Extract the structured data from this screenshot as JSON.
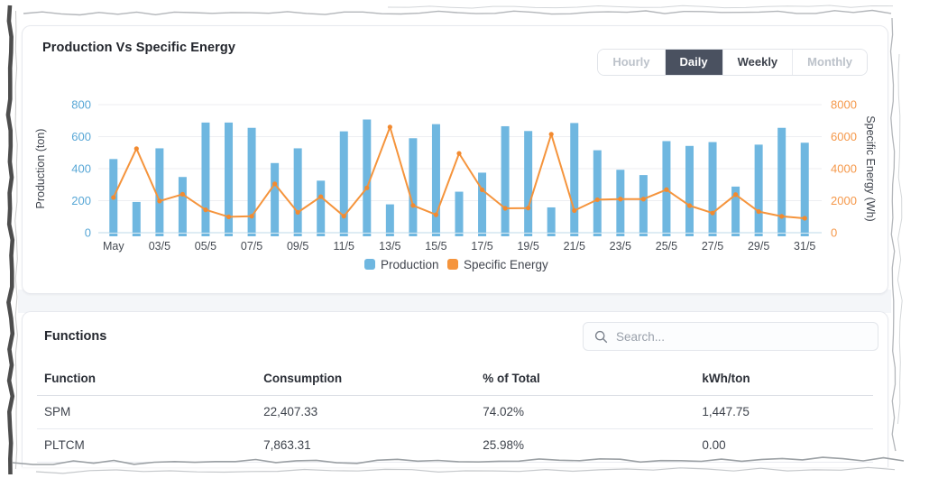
{
  "chart_card": {
    "title": "Production Vs Specific Energy",
    "range_tabs": [
      {
        "label": "Hourly",
        "state": "muted"
      },
      {
        "label": "Daily",
        "state": "active"
      },
      {
        "label": "Weekly",
        "state": "normal"
      },
      {
        "label": "Monthly",
        "state": "muted"
      }
    ],
    "active_tab": "Daily"
  },
  "chart_data": {
    "type": "bar+line-dual-axis",
    "title": "Production Vs Specific Energy",
    "categories": [
      "May",
      "02/5",
      "03/5",
      "04/5",
      "05/5",
      "06/5",
      "07/5",
      "08/5",
      "09/5",
      "10/5",
      "11/5",
      "12/5",
      "13/5",
      "14/5",
      "15/5",
      "16/5",
      "17/5",
      "18/5",
      "19/5",
      "20/5",
      "21/5",
      "22/5",
      "23/5",
      "24/5",
      "25/5",
      "26/5",
      "27/5",
      "28/5",
      "29/5",
      "30/5",
      "31/5"
    ],
    "label_every": 2,
    "series": [
      {
        "name": "Production",
        "type": "bar",
        "axis": "left",
        "color": "#6fb7e0",
        "values": [
          460,
          192,
          527,
          348,
          688,
          688,
          655,
          435,
          527,
          325,
          633,
          707,
          177,
          590,
          678,
          256,
          375,
          665,
          635,
          158,
          685,
          515,
          393,
          360,
          572,
          542,
          566,
          288,
          550,
          655,
          562
        ]
      },
      {
        "name": "Specific Energy",
        "type": "line",
        "axis": "right",
        "color": "#f5943c",
        "marker_color": "#f28a30",
        "values": [
          2200,
          5250,
          1980,
          2400,
          1430,
          990,
          1030,
          3050,
          1270,
          2250,
          1030,
          2800,
          6600,
          1700,
          1120,
          4950,
          2680,
          1520,
          1540,
          6150,
          1380,
          2060,
          2100,
          2100,
          2690,
          1690,
          1230,
          2380,
          1320,
          1020,
          900
        ]
      }
    ],
    "axes": {
      "left": {
        "label": "Production (ton)",
        "min": 0,
        "max": 800,
        "ticks": [
          0,
          200,
          400,
          600,
          800
        ],
        "color": "#58a7d6"
      },
      "right": {
        "label": "Specific Energy (Wh)",
        "min": 0,
        "max": 8000,
        "ticks": [
          0,
          2000,
          4000,
          6000,
          8000
        ],
        "color": "#f5984a"
      }
    },
    "legend": {
      "position": "bottom",
      "items": [
        "Production",
        "Specific Energy"
      ]
    },
    "grid": true,
    "gridline_color": "#edeef2",
    "baseline_color": "#bcd8ea",
    "x_label_color": "#454a52"
  },
  "functions_card": {
    "title": "Functions",
    "search": {
      "placeholder": "Search..."
    },
    "table": {
      "headers": [
        "Function",
        "Consumption",
        "% of Total",
        "kWh/ton"
      ],
      "rows": [
        [
          "SPM",
          "22,407.33",
          "74.02%",
          "1,447.75"
        ],
        [
          "PLTCM",
          "7,863.31",
          "25.98%",
          "0.00"
        ]
      ]
    }
  }
}
